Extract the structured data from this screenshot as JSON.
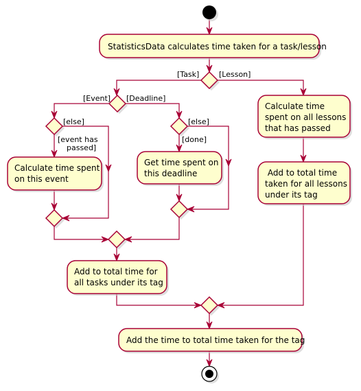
{
  "diagram": {
    "type": "activity",
    "colors": {
      "node_fill": "#FEFECE",
      "edge": "#A80036",
      "start_end": "#000000"
    },
    "nodes": {
      "start": {
        "kind": "start"
      },
      "calc_task_lesson": {
        "kind": "action",
        "lines": [
          "StatisticsData calculates time taken for a task/lesson"
        ]
      },
      "task_or_lesson": {
        "kind": "decision"
      },
      "event_or_deadline": {
        "kind": "decision"
      },
      "event_passed_check": {
        "kind": "decision"
      },
      "calc_event": {
        "kind": "action",
        "lines": [
          "Calculate time spent",
          "on this event"
        ]
      },
      "event_merge": {
        "kind": "merge"
      },
      "deadline_done_check": {
        "kind": "decision"
      },
      "get_deadline": {
        "kind": "action",
        "lines": [
          "Get time spent on",
          "this deadline"
        ]
      },
      "deadline_merge": {
        "kind": "merge"
      },
      "task_merge": {
        "kind": "merge"
      },
      "add_tasks": {
        "kind": "action",
        "lines": [
          "Add to total time for",
          "all tasks under its tag"
        ]
      },
      "calc_lessons": {
        "kind": "action",
        "lines": [
          "Calculate time",
          "spent on all lessons",
          "that has passed"
        ]
      },
      "add_lessons": {
        "kind": "action",
        "lines": [
          " Add to total time",
          "taken for all lessons",
          "under its tag"
        ]
      },
      "final_merge": {
        "kind": "merge"
      },
      "add_tag_total": {
        "kind": "action",
        "lines": [
          "Add the time to total time taken for the tag"
        ]
      },
      "end": {
        "kind": "end"
      }
    },
    "guards": {
      "task": "[Task]",
      "lesson": "[Lesson]",
      "event": "[Event]",
      "deadline": "[Deadline]",
      "event_else": "[else]",
      "event_passed_line1": "[event has",
      "event_passed_line2": "passed]",
      "deadline_else": "[else]",
      "deadline_done": "[done]"
    },
    "edges": [
      [
        "start",
        "calc_task_lesson"
      ],
      [
        "calc_task_lesson",
        "task_or_lesson"
      ],
      [
        "task_or_lesson",
        "event_or_deadline",
        "[Task]"
      ],
      [
        "task_or_lesson",
        "calc_lessons",
        "[Lesson]"
      ],
      [
        "event_or_deadline",
        "event_passed_check",
        "[Event]"
      ],
      [
        "event_or_deadline",
        "deadline_done_check",
        "[Deadline]"
      ],
      [
        "event_passed_check",
        "calc_event",
        "[event has passed]"
      ],
      [
        "event_passed_check",
        "event_merge",
        "[else]"
      ],
      [
        "calc_event",
        "event_merge"
      ],
      [
        "deadline_done_check",
        "get_deadline",
        "[done]"
      ],
      [
        "deadline_done_check",
        "deadline_merge",
        "[else]"
      ],
      [
        "get_deadline",
        "deadline_merge"
      ],
      [
        "event_merge",
        "task_merge"
      ],
      [
        "deadline_merge",
        "task_merge"
      ],
      [
        "task_merge",
        "add_tasks"
      ],
      [
        "calc_lessons",
        "add_lessons"
      ],
      [
        "add_tasks",
        "final_merge"
      ],
      [
        "add_lessons",
        "final_merge"
      ],
      [
        "final_merge",
        "add_tag_total"
      ],
      [
        "add_tag_total",
        "end"
      ]
    ]
  }
}
